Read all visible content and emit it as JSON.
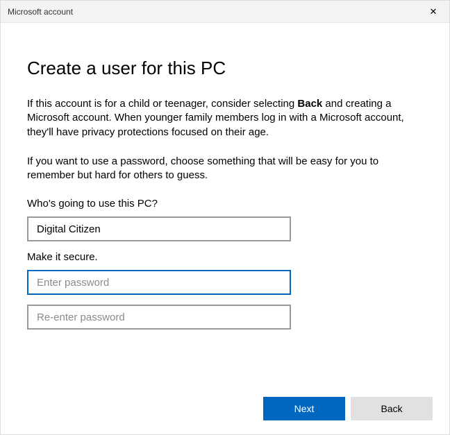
{
  "titlebar": {
    "title": "Microsoft account"
  },
  "page": {
    "heading": "Create a user for this PC",
    "intro1_a": "If this account is for a child or teenager, consider selecting ",
    "intro1_bold": "Back",
    "intro1_b": " and creating a Microsoft account. When younger family members log in with a Microsoft account, they'll have privacy protections focused on their age.",
    "intro2": "If you want to use a password, choose something that will be easy for you to remember but hard for others to guess.",
    "who_label": "Who's going to use this PC?",
    "username_value": "Digital Citizen",
    "secure_label": "Make it secure.",
    "password_placeholder": "Enter password",
    "password_value": "",
    "reenter_placeholder": "Re-enter password",
    "reenter_value": ""
  },
  "footer": {
    "next_label": "Next",
    "back_label": "Back"
  }
}
